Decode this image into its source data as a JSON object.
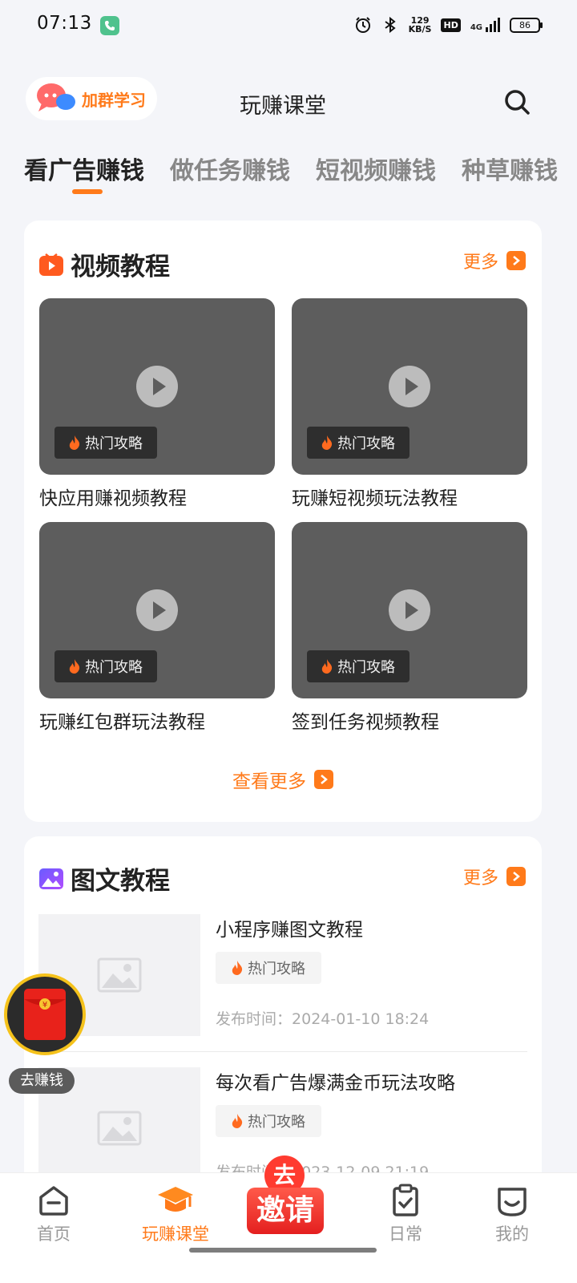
{
  "status_bar": {
    "time": "07:13",
    "speed_top": "129",
    "speed_bottom": "KB/S",
    "hd": "HD",
    "network": "4G",
    "battery": "86"
  },
  "header": {
    "group_label": "加群学习",
    "title": "玩赚课堂"
  },
  "tabs": [
    {
      "label": "看广告赚钱"
    },
    {
      "label": "做任务赚钱"
    },
    {
      "label": "短视频赚钱"
    },
    {
      "label": "种草赚钱"
    }
  ],
  "video_section": {
    "title": "视频教程",
    "more": "更多",
    "badge": "热门攻略",
    "items": [
      {
        "label": "快应用赚视频教程"
      },
      {
        "label": "玩赚短视频玩法教程"
      },
      {
        "label": "玩赚红包群玩法教程"
      },
      {
        "label": "签到任务视频教程"
      }
    ],
    "see_more": "查看更多"
  },
  "article_section": {
    "title": "图文教程",
    "more": "更多",
    "badge": "热门攻略",
    "time_prefix": "发布时间：",
    "items": [
      {
        "title": "小程序赚图文教程",
        "time": "2024-01-10 18:24"
      },
      {
        "title": "每次看广告爆满金币玩法攻略",
        "time": "2023-12-09 21:19"
      }
    ]
  },
  "floating": {
    "packet_symbol": "¥",
    "label": "去赚钱"
  },
  "bottom_nav": {
    "items": [
      {
        "label": "首页"
      },
      {
        "label": "玩赚课堂"
      },
      {
        "label": "日常"
      },
      {
        "label": "我的"
      }
    ],
    "invite_top": "去",
    "invite_main": "邀请"
  },
  "colors": {
    "accent": "#ff7a1a",
    "background": "#f4f5f9"
  }
}
